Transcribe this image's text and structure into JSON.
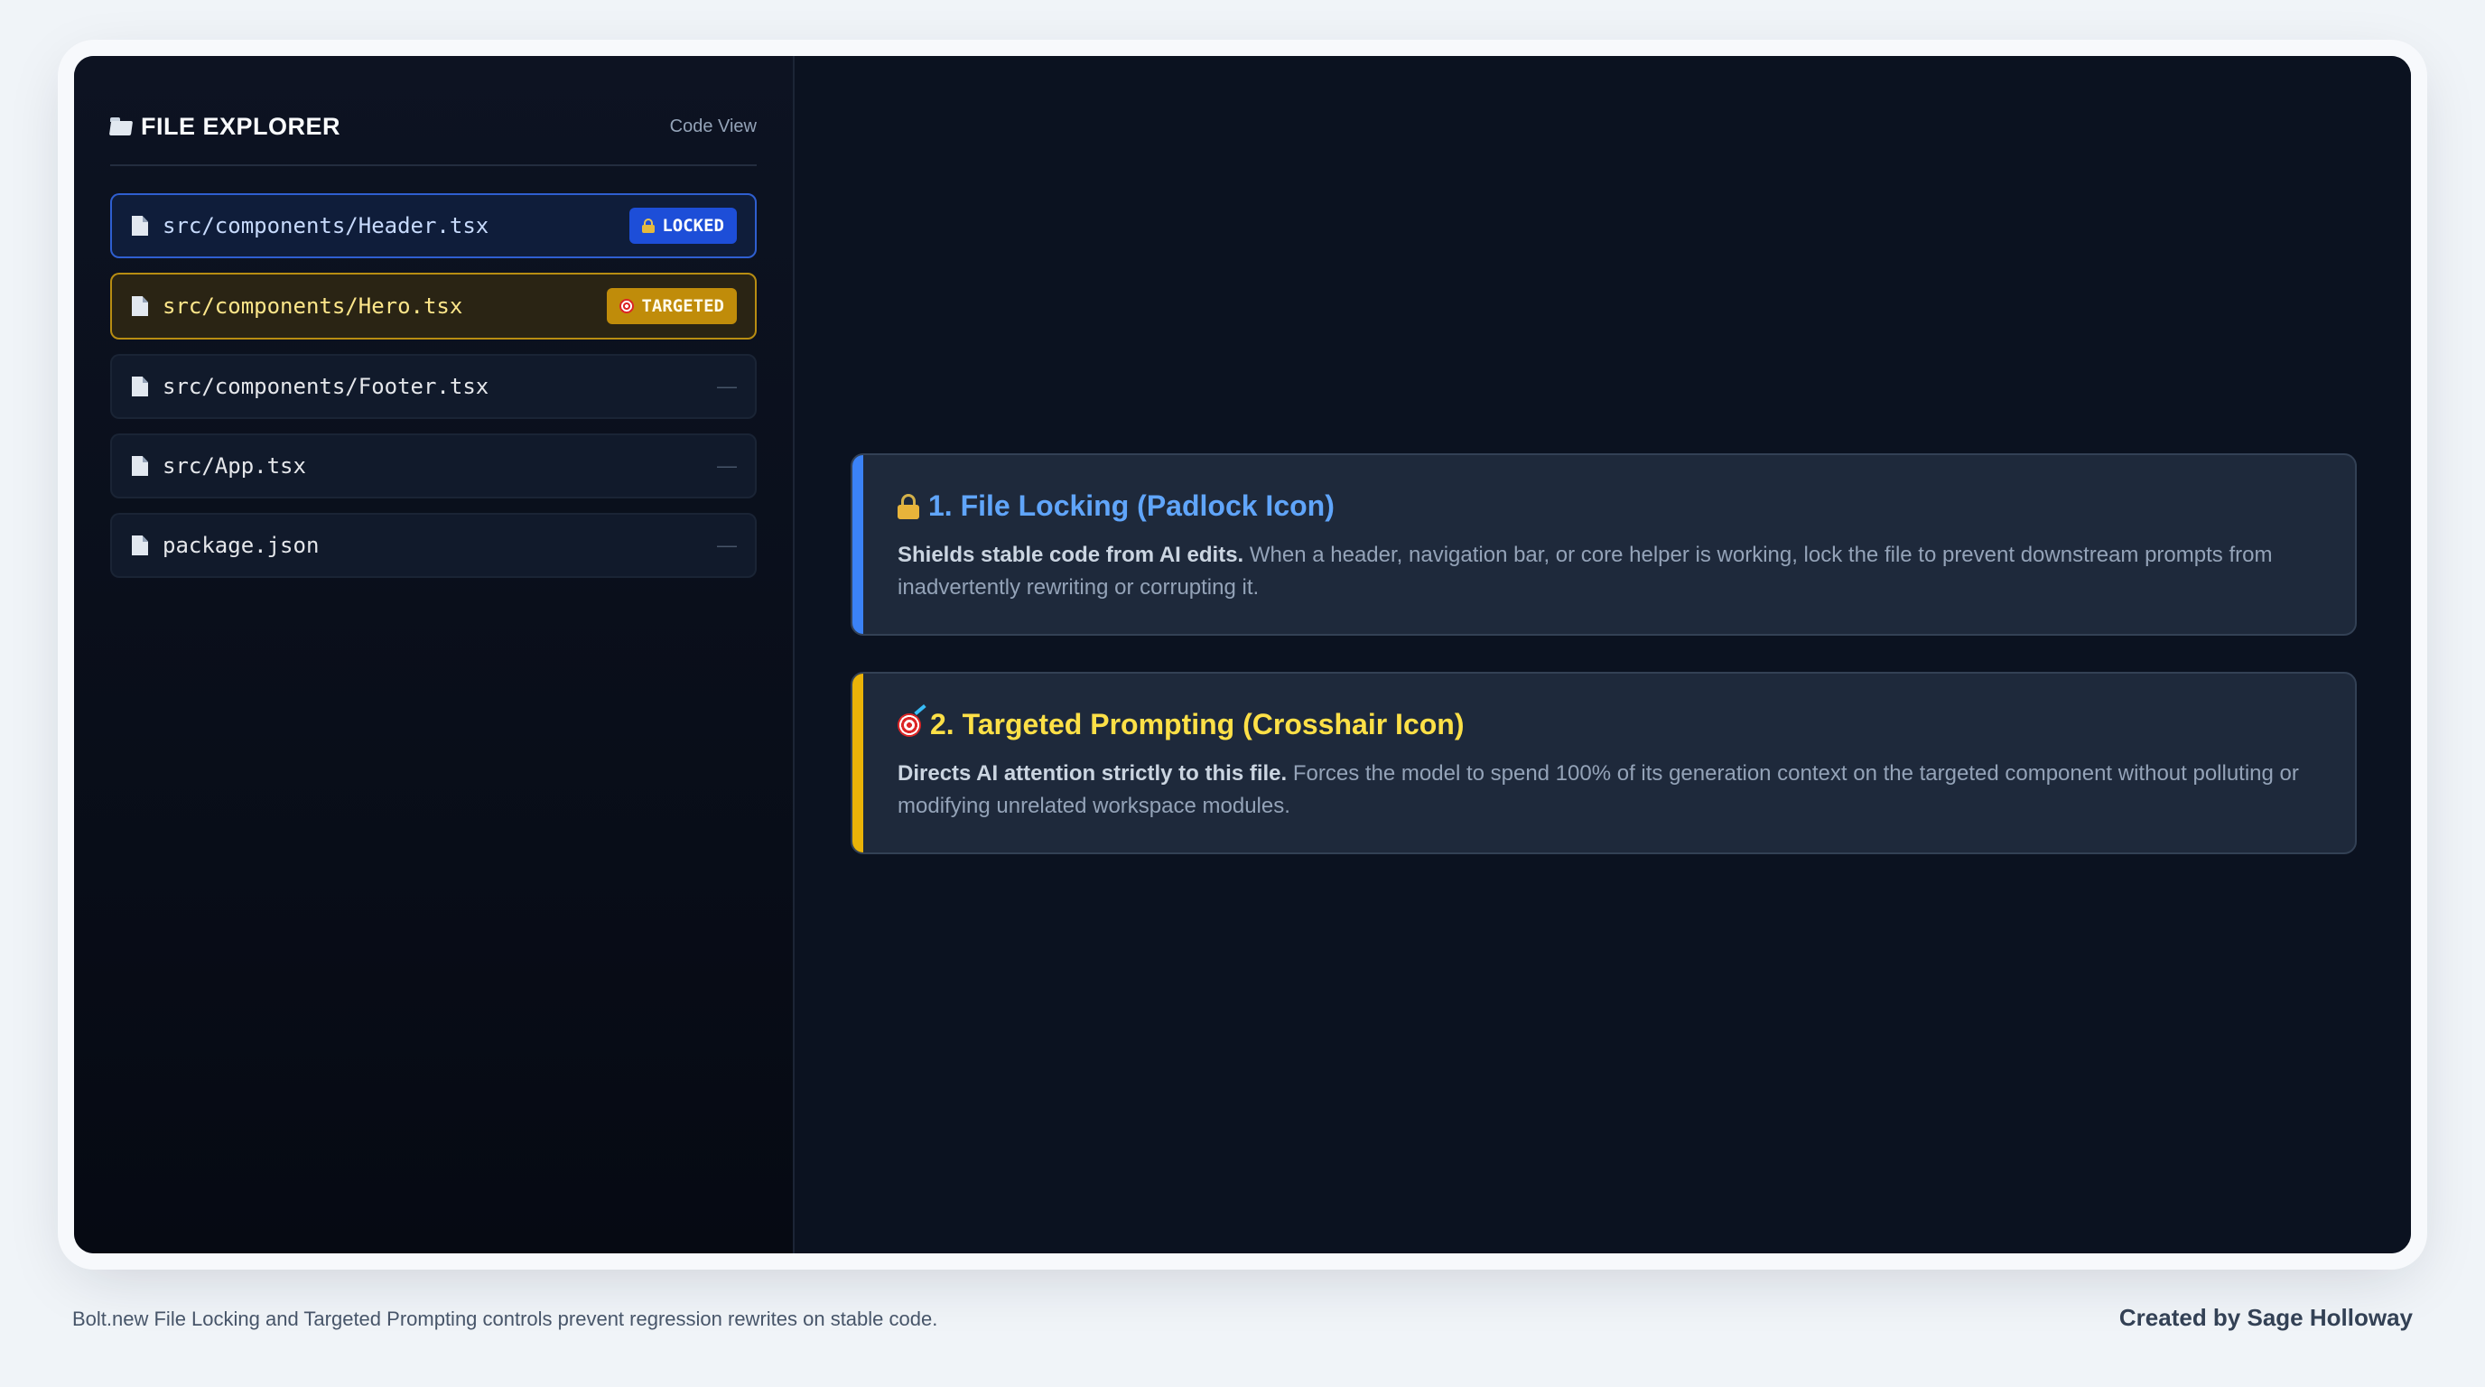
{
  "sidebar": {
    "title": "FILE EXPLORER",
    "view_label": "Code View",
    "files": [
      {
        "name": "src/components/Header.tsx",
        "status": "LOCKED"
      },
      {
        "name": "src/components/Hero.tsx",
        "status": "TARGETED"
      },
      {
        "name": "src/components/Footer.tsx",
        "status": "—"
      },
      {
        "name": "src/App.tsx",
        "status": "—"
      },
      {
        "name": "package.json",
        "status": "—"
      }
    ]
  },
  "cards": [
    {
      "title": "1. File Locking (Padlock Icon)",
      "lead": "Shields stable code from AI edits.",
      "body": " When a header, navigation bar, or core helper is working, lock the file to prevent downstream prompts from inadvertently rewriting or corrupting it."
    },
    {
      "title": "2. Targeted Prompting (Crosshair Icon)",
      "lead": "Directs AI attention strictly to this file.",
      "body": " Forces the model to spend 100% of its generation context on the targeted component without polluting or modifying unrelated workspace modules."
    }
  ],
  "footer": {
    "caption": "Bolt.new File Locking and Targeted Prompting controls prevent regression rewrites on stable code.",
    "credit": "Created by Sage Holloway"
  },
  "colors": {
    "locked_accent": "#3b82f6",
    "targeted_accent": "#eab308"
  }
}
